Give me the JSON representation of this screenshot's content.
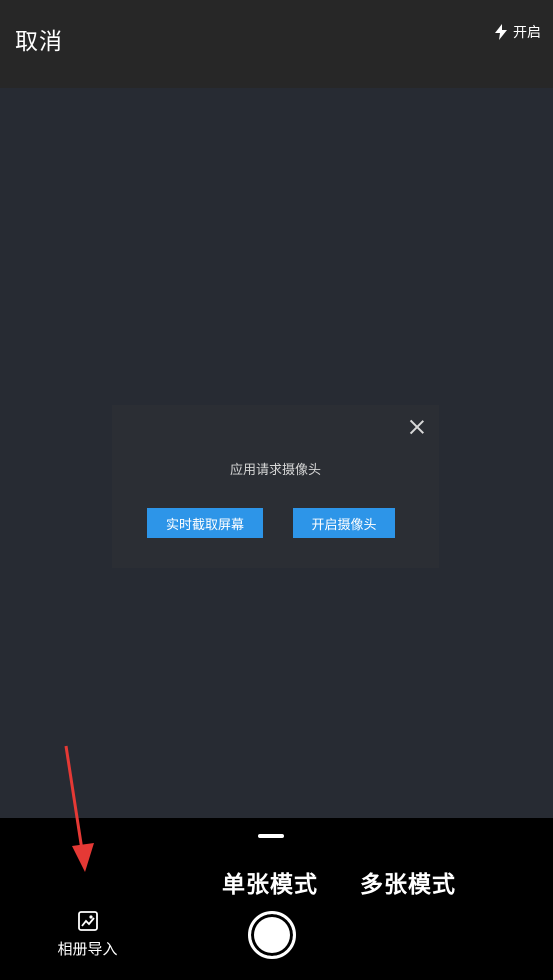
{
  "header": {
    "cancel_label": "取消",
    "flash_label": "开启"
  },
  "dialog": {
    "message": "应用请求摄像头",
    "screen_capture_label": "实时截取屏幕",
    "open_camera_label": "开启摄像头"
  },
  "bottom": {
    "modes": [
      {
        "label": "单张模式",
        "selected": true
      },
      {
        "label": "多张模式",
        "selected": false
      }
    ],
    "album_label": "相册导入"
  },
  "icons": {
    "flash": "flash-icon",
    "close": "close-icon",
    "album": "gallery-icon",
    "shutter": "shutter-button",
    "annotation": "red-arrow"
  },
  "colors": {
    "accent_button": "#2d95e8",
    "background": "#272b33",
    "annotation_arrow": "#e53935"
  }
}
